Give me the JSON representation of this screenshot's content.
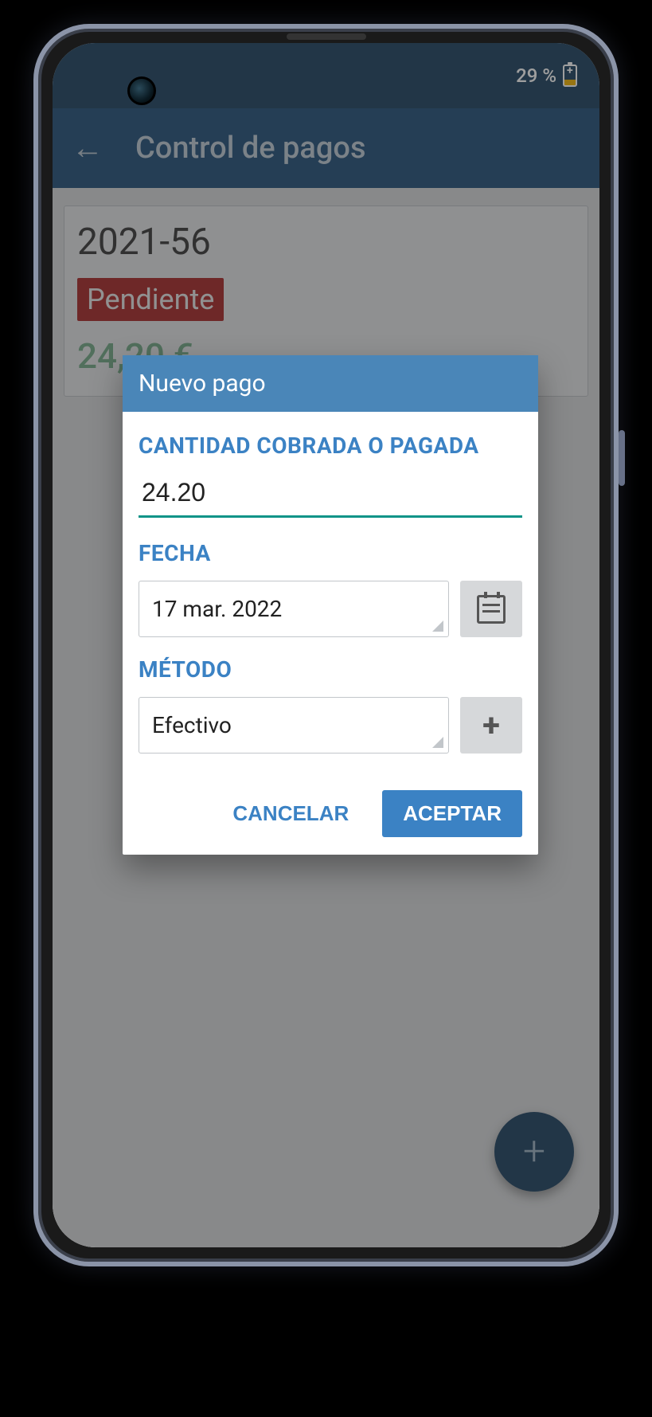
{
  "status_bar": {
    "battery_percent": "29 %"
  },
  "app_bar": {
    "title": "Control de pagos"
  },
  "invoice": {
    "id": "2021-56",
    "status": "Pendiente",
    "amount": "24,20 €"
  },
  "dialog": {
    "title": "Nuevo pago",
    "amount_label": "CANTIDAD COBRADA O PAGADA",
    "amount_value": "24.20",
    "date_label": "FECHA",
    "date_value": "17 mar. 2022",
    "method_label": "MÉTODO",
    "method_value": "Efectivo",
    "cancel": "CANCELAR",
    "accept": "ACEPTAR"
  },
  "fab": {
    "glyph": "+"
  }
}
